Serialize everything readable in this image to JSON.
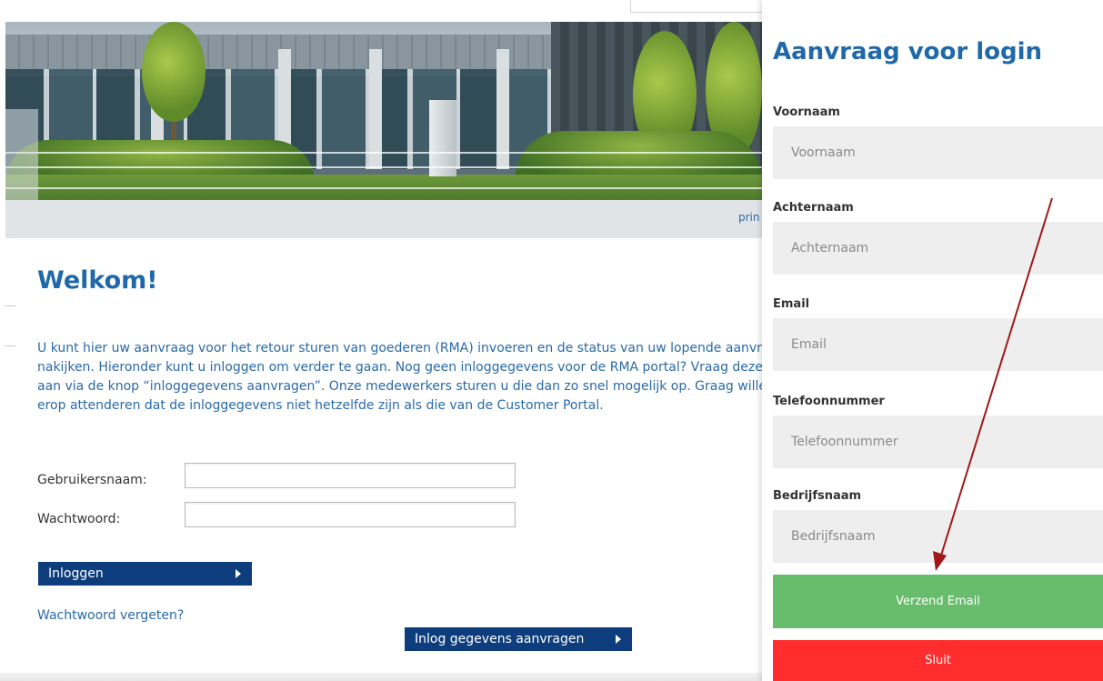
{
  "page": {
    "print_link": "prin",
    "welcome_title": "Welkom!",
    "intro_lines": [
      "U kunt hier uw aanvraag voor het retour sturen van goederen (RMA) invoeren en de status van uw lopende aanvraag",
      "nakijken. Hieronder kunt u inloggen om verder te gaan. Nog geen inloggegevens voor de RMA portal? Vraag deze dan",
      "aan via de knop “inloggegevens aanvragen”. Onze medewerkers sturen u die dan zo snel mogelijk op. Graag willen wij",
      "erop attenderen dat de inloggegevens niet hetzelfde zijn als die van de Customer Portal."
    ],
    "username_label": "Gebruikersnaam:",
    "password_label": "Wachtwoord:",
    "login_button": "Inloggen",
    "forgot_link": "Wachtwoord vergeten?",
    "request_button": "Inlog gegevens aanvragen"
  },
  "panel": {
    "title": "Aanvraag voor login",
    "fields": [
      {
        "label": "Voornaam",
        "placeholder": "Voornaam"
      },
      {
        "label": "Achternaam",
        "placeholder": "Achternaam"
      },
      {
        "label": "Email",
        "placeholder": "Email"
      },
      {
        "label": "Telefoonnummer",
        "placeholder": "Telefoonnummer"
      },
      {
        "label": "Bedrijfsnaam",
        "placeholder": "Bedrijfsnaam"
      }
    ],
    "send_button": "Verzend Email",
    "close_button": "Sluit"
  },
  "colors": {
    "title_blue": "#1f69aa",
    "button_navy": "#0d3d7c",
    "send_green": "#67bd6b",
    "close_red": "#ff2d2d",
    "annotation_arrow": "#a01818"
  },
  "icons": [
    "arrow-right-icon",
    "annotation-arrow"
  ]
}
